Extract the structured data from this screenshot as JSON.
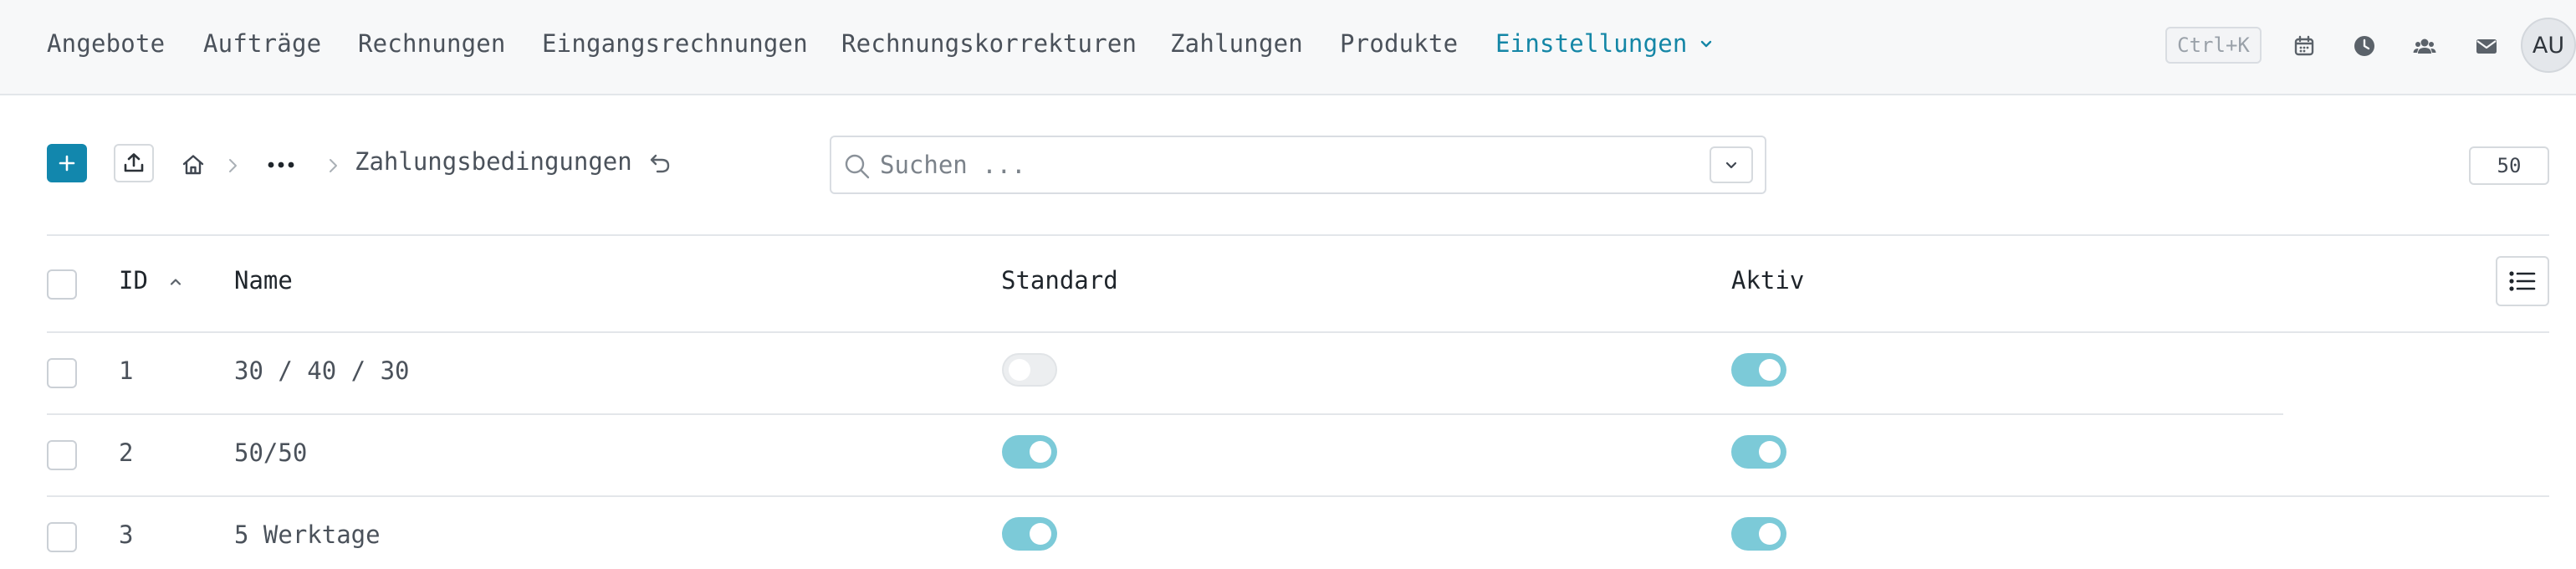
{
  "nav": {
    "items": [
      "Angebote",
      "Aufträge",
      "Rechnungen",
      "Eingangsrechnungen",
      "Rechnungskorrekturen",
      "Zahlungen",
      "Produkte"
    ],
    "active": "Einstellungen",
    "shortcut": "Ctrl+K",
    "icons": [
      "calendar-icon",
      "clock-icon",
      "users-icon",
      "mail-icon"
    ],
    "avatar": "AU",
    "accent": "#1486a6"
  },
  "toolbar": {
    "breadcrumb_title": "Zahlungsbedingungen",
    "search_placeholder": "Suchen ...",
    "page_size": "50"
  },
  "table": {
    "headers": {
      "id": "ID",
      "name": "Name",
      "standard": "Standard",
      "active": "Aktiv"
    },
    "sort": "ID ascending",
    "rows": [
      {
        "id": "1",
        "name": "30 / 40 / 30",
        "standard": false,
        "active": true
      },
      {
        "id": "2",
        "name": "50/50",
        "standard": true,
        "active": true
      },
      {
        "id": "3",
        "name": "5 Werktage",
        "standard": true,
        "active": true
      }
    ]
  }
}
